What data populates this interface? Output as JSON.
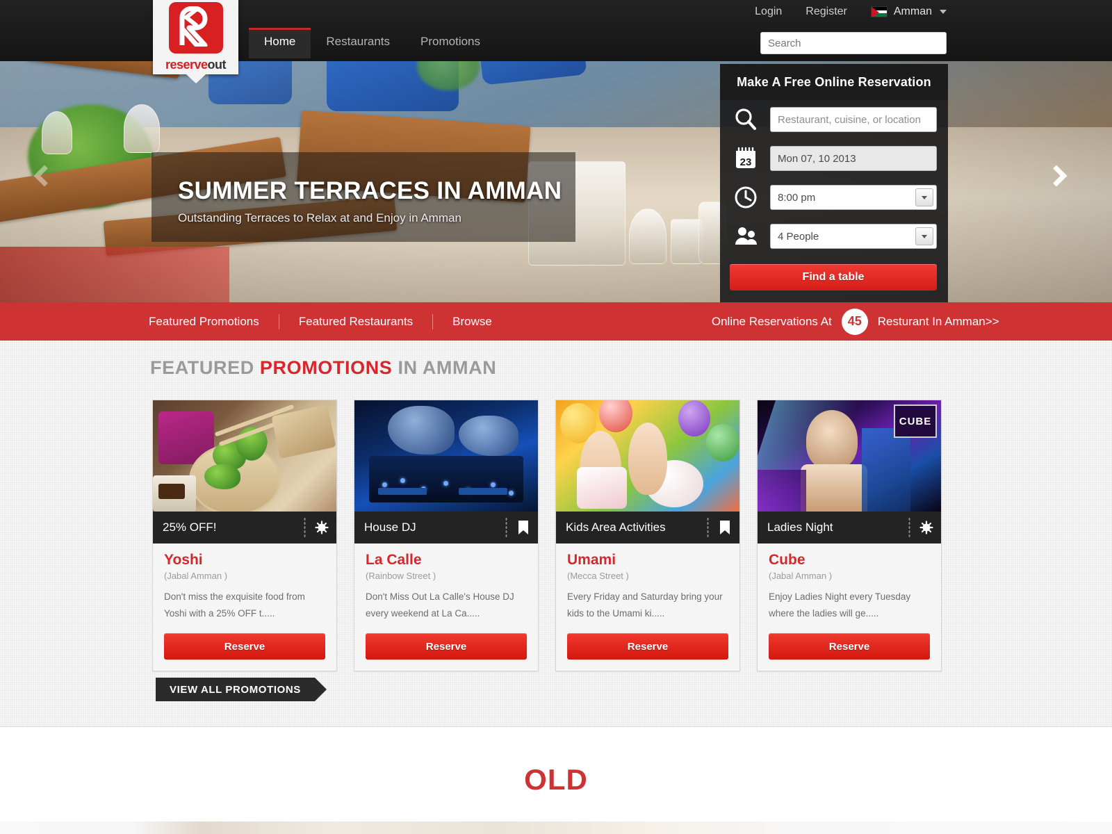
{
  "header": {
    "utility": {
      "login": "Login",
      "register": "Register",
      "city": "Amman",
      "flag_icon": "jordan-flag-icon"
    },
    "logo": {
      "word_a": "reserve",
      "word_b": "out"
    },
    "nav": [
      {
        "label": "Home",
        "active": true
      },
      {
        "label": "Restaurants",
        "active": false
      },
      {
        "label": "Promotions",
        "active": false
      }
    ],
    "search": {
      "placeholder": "Search",
      "value": ""
    }
  },
  "hero": {
    "title": "SUMMER TERRACES IN AMMAN",
    "subtitle": "Outstanding Terraces to Relax at and Enjoy in Amman",
    "prev_icon": "chevron-left-icon",
    "next_icon": "chevron-right-icon"
  },
  "reservation": {
    "title": "Make A Free Online Reservation",
    "search_icon": "magnifier-icon",
    "calendar_icon": "calendar-icon",
    "calendar_day": "23",
    "clock_icon": "clock-icon",
    "people_icon": "people-icon",
    "restaurant_placeholder": "Restaurant, cuisine, or location",
    "restaurant_value": "",
    "date_value": "Mon 07, 10 2013",
    "time_value": "8:00 pm",
    "party_value": "4 People",
    "submit_label": "Find a table"
  },
  "redbar": {
    "links": [
      "Featured Promotions",
      "Featured Restaurants",
      "Browse"
    ],
    "stat_prefix": "Online Reservations At",
    "stat_count": "45",
    "stat_suffix": "Resturant In Amman>>"
  },
  "featured": {
    "title_pre": "FEATURED ",
    "title_hl": "PROMOTIONS",
    "title_post": " IN AMMAN",
    "view_all_label": "VIEW ALL PROMOTIONS",
    "reserve_label": "Reserve",
    "cards": [
      {
        "promo": "25% OFF!",
        "badge_icon": "sun-burst-icon",
        "restaurant": "Yoshi",
        "location": "(Jabal Amman )",
        "desc": "Don't miss the exquisite food from Yoshi with a 25% OFF t.....",
        "image": "food-dim-sum-photo"
      },
      {
        "promo": "House DJ",
        "badge_icon": "bookmark-icon",
        "restaurant": "La Calle",
        "location": "(Rainbow Street )",
        "desc": "Don't Miss Out La Calle's House DJ every weekend at La Ca.....",
        "image": "dj-mixer-photo"
      },
      {
        "promo": "Kids Area Activities",
        "badge_icon": "bookmark-icon",
        "restaurant": "Umami",
        "location": "(Mecca Street )",
        "desc": "Every Friday and Saturday bring your kids to the Umami ki.....",
        "image": "kids-balloons-photo"
      },
      {
        "promo": "Ladies Night",
        "badge_icon": "sun-burst-icon",
        "restaurant": "Cube",
        "location": "(Jabal Amman )",
        "desc": "Enjoy Ladies Night every Tuesday where the ladies will ge.....",
        "image": "nightclub-photo",
        "overlay_logo": "CUBE"
      }
    ]
  },
  "footer": {
    "label": "OLD"
  },
  "colors": {
    "brand_red": "#d8262a",
    "bar_red": "#cf3232",
    "dark": "#1b1b1b"
  }
}
